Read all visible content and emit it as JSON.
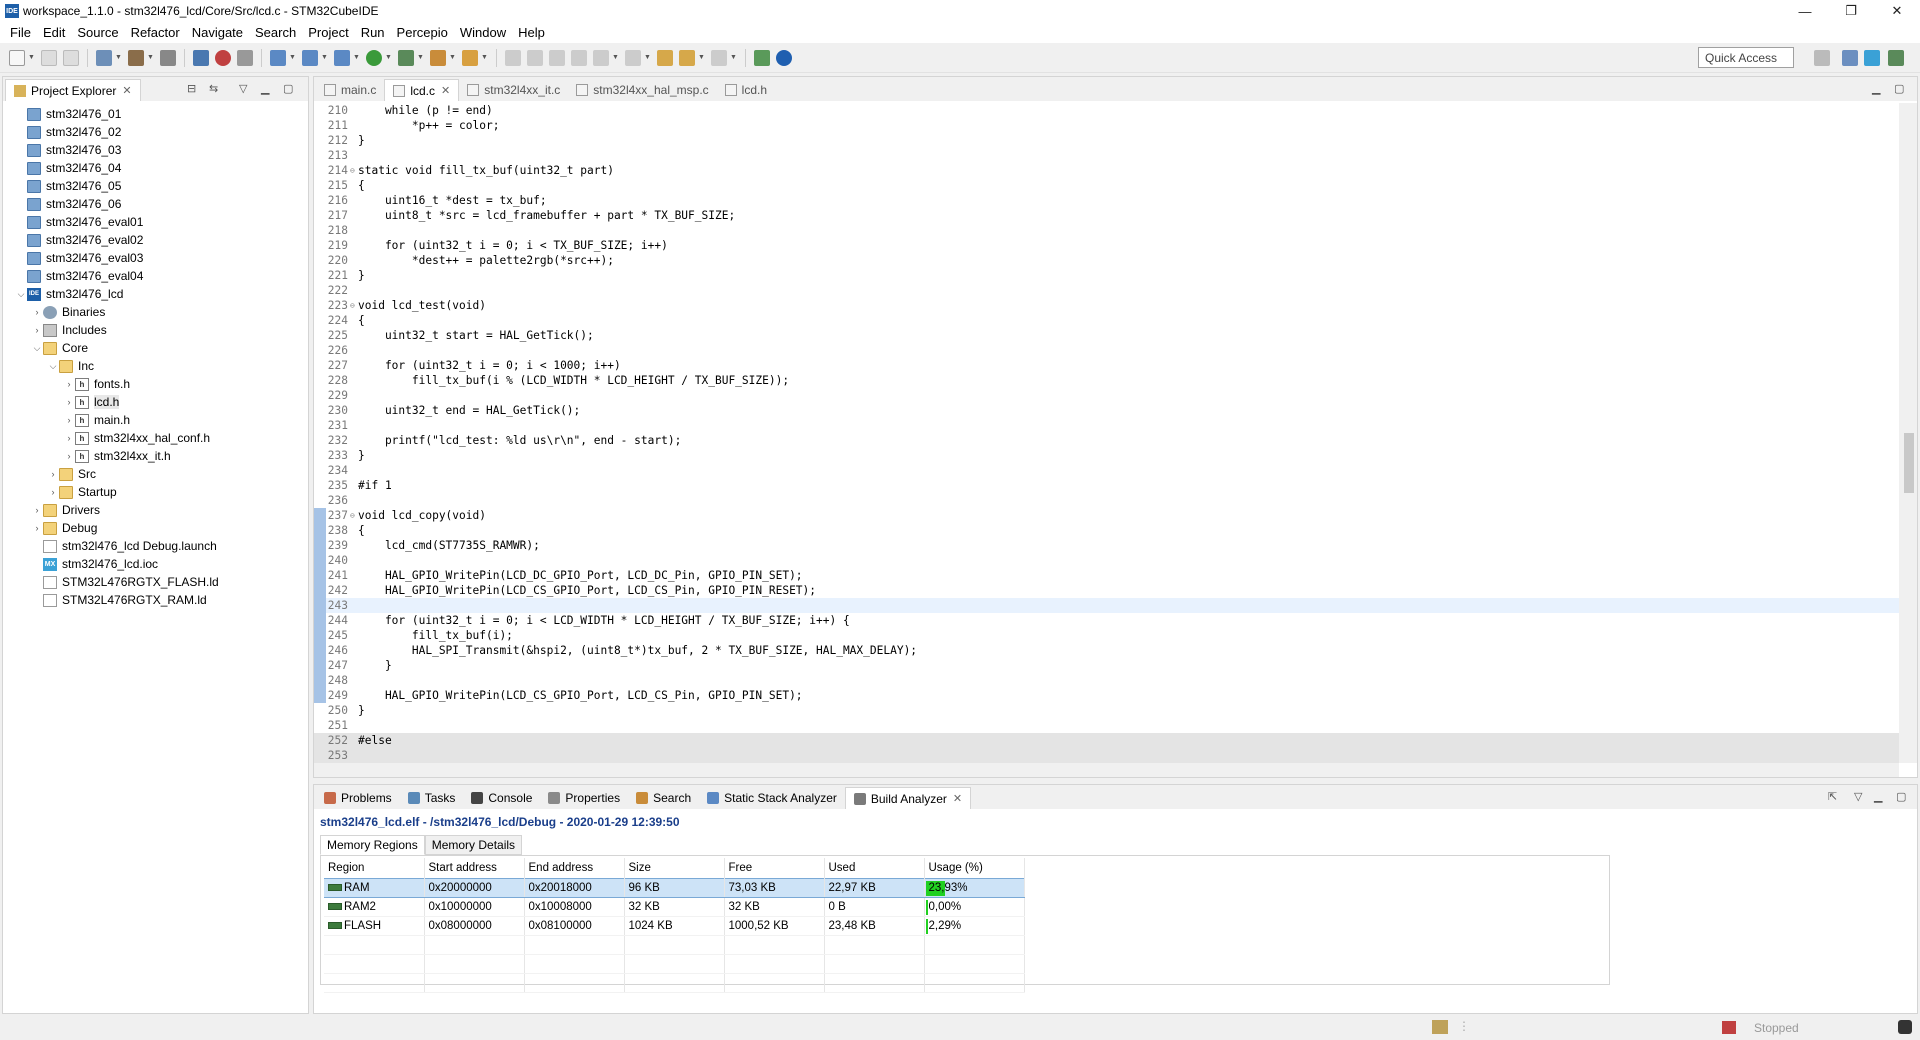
{
  "window": {
    "title": "workspace_1.1.0 - stm32l476_lcd/Core/Src/lcd.c - STM32CubeIDE",
    "app_icon_text": "IDE",
    "minimize": "—",
    "maximize": "❐",
    "close": "✕"
  },
  "menu": [
    "File",
    "Edit",
    "Source",
    "Refactor",
    "Navigate",
    "Search",
    "Project",
    "Run",
    "Percepio",
    "Window",
    "Help"
  ],
  "quick_access": "Quick Access",
  "explorer": {
    "title": "Project Explorer",
    "items": [
      {
        "label": "stm32l476_01",
        "icon": "project",
        "level": 0,
        "toggle": ""
      },
      {
        "label": "stm32l476_02",
        "icon": "project",
        "level": 0,
        "toggle": ""
      },
      {
        "label": "stm32l476_03",
        "icon": "project",
        "level": 0,
        "toggle": ""
      },
      {
        "label": "stm32l476_04",
        "icon": "project",
        "level": 0,
        "toggle": ""
      },
      {
        "label": "stm32l476_05",
        "icon": "project",
        "level": 0,
        "toggle": ""
      },
      {
        "label": "stm32l476_06",
        "icon": "project",
        "level": 0,
        "toggle": ""
      },
      {
        "label": "stm32l476_eval01",
        "icon": "project",
        "level": 0,
        "toggle": ""
      },
      {
        "label": "stm32l476_eval02",
        "icon": "project",
        "level": 0,
        "toggle": ""
      },
      {
        "label": "stm32l476_eval03",
        "icon": "project",
        "level": 0,
        "toggle": ""
      },
      {
        "label": "stm32l476_eval04",
        "icon": "project",
        "level": 0,
        "toggle": ""
      },
      {
        "label": "stm32l476_lcd",
        "icon": "ide",
        "level": 0,
        "toggle": "open"
      },
      {
        "label": "Binaries",
        "icon": "bin",
        "level": 1,
        "toggle": "closed"
      },
      {
        "label": "Includes",
        "icon": "inc",
        "level": 1,
        "toggle": "closed"
      },
      {
        "label": "Core",
        "icon": "folder",
        "level": 1,
        "toggle": "open"
      },
      {
        "label": "Inc",
        "icon": "folder",
        "level": 2,
        "toggle": "open"
      },
      {
        "label": "fonts.h",
        "icon": "h",
        "level": 3,
        "toggle": "closed"
      },
      {
        "label": "lcd.h",
        "icon": "h",
        "level": 3,
        "toggle": "closed",
        "selected": true
      },
      {
        "label": "main.h",
        "icon": "h",
        "level": 3,
        "toggle": "closed"
      },
      {
        "label": "stm32l4xx_hal_conf.h",
        "icon": "h",
        "level": 3,
        "toggle": "closed"
      },
      {
        "label": "stm32l4xx_it.h",
        "icon": "h",
        "level": 3,
        "toggle": "closed"
      },
      {
        "label": "Src",
        "icon": "folder",
        "level": 2,
        "toggle": "closed"
      },
      {
        "label": "Startup",
        "icon": "folder",
        "level": 2,
        "toggle": "closed"
      },
      {
        "label": "Drivers",
        "icon": "folder",
        "level": 1,
        "toggle": "closed"
      },
      {
        "label": "Debug",
        "icon": "folder",
        "level": 1,
        "toggle": "closed"
      },
      {
        "label": "stm32l476_lcd Debug.launch",
        "icon": "file",
        "level": 1,
        "toggle": ""
      },
      {
        "label": "stm32l476_lcd.ioc",
        "icon": "mx",
        "level": 1,
        "toggle": ""
      },
      {
        "label": "STM32L476RGTX_FLASH.ld",
        "icon": "file",
        "level": 1,
        "toggle": ""
      },
      {
        "label": "STM32L476RGTX_RAM.ld",
        "icon": "file",
        "level": 1,
        "toggle": ""
      }
    ]
  },
  "editor": {
    "tabs": [
      {
        "label": "main.c",
        "active": false
      },
      {
        "label": "lcd.c",
        "active": true
      },
      {
        "label": "stm32l4xx_it.c",
        "active": false
      },
      {
        "label": "stm32l4xx_hal_msp.c",
        "active": false
      },
      {
        "label": "lcd.h",
        "active": false
      }
    ],
    "lines": [
      {
        "n": "210",
        "t": "    while (p != end)"
      },
      {
        "n": "211",
        "t": "        *p++ = color;"
      },
      {
        "n": "212",
        "t": "}"
      },
      {
        "n": "213",
        "t": ""
      },
      {
        "n": "214",
        "t": "static void fill_tx_buf(uint32_t part)",
        "fold": true
      },
      {
        "n": "215",
        "t": "{"
      },
      {
        "n": "216",
        "t": "    uint16_t *dest = tx_buf;"
      },
      {
        "n": "217",
        "t": "    uint8_t *src = lcd_framebuffer + part * TX_BUF_SIZE;"
      },
      {
        "n": "218",
        "t": ""
      },
      {
        "n": "219",
        "t": "    for (uint32_t i = 0; i < TX_BUF_SIZE; i++)"
      },
      {
        "n": "220",
        "t": "        *dest++ = palette2rgb(*src++);"
      },
      {
        "n": "221",
        "t": "}"
      },
      {
        "n": "222",
        "t": ""
      },
      {
        "n": "223",
        "t": "void lcd_test(void)",
        "fold": true
      },
      {
        "n": "224",
        "t": "{"
      },
      {
        "n": "225",
        "t": "    uint32_t start = HAL_GetTick();"
      },
      {
        "n": "226",
        "t": ""
      },
      {
        "n": "227",
        "t": "    for (uint32_t i = 0; i < 1000; i++)"
      },
      {
        "n": "228",
        "t": "        fill_tx_buf(i % (LCD_WIDTH * LCD_HEIGHT / TX_BUF_SIZE));"
      },
      {
        "n": "229",
        "t": ""
      },
      {
        "n": "230",
        "t": "    uint32_t end = HAL_GetTick();"
      },
      {
        "n": "231",
        "t": ""
      },
      {
        "n": "232",
        "t": "    printf(\"lcd_test: %ld us\\r\\n\", end - start);"
      },
      {
        "n": "233",
        "t": "}"
      },
      {
        "n": "234",
        "t": ""
      },
      {
        "n": "235",
        "t": "#if 1"
      },
      {
        "n": "236",
        "t": ""
      },
      {
        "n": "237",
        "t": "void lcd_copy(void)",
        "fold": true,
        "mark": true
      },
      {
        "n": "238",
        "t": "{",
        "mark": true
      },
      {
        "n": "239",
        "t": "    lcd_cmd(ST7735S_RAMWR);",
        "mark": true
      },
      {
        "n": "240",
        "t": "",
        "mark": true
      },
      {
        "n": "241",
        "t": "    HAL_GPIO_WritePin(LCD_DC_GPIO_Port, LCD_DC_Pin, GPIO_PIN_SET);",
        "mark": true
      },
      {
        "n": "242",
        "t": "    HAL_GPIO_WritePin(LCD_CS_GPIO_Port, LCD_CS_Pin, GPIO_PIN_RESET);",
        "mark": true
      },
      {
        "n": "243",
        "t": "",
        "mark": true,
        "hl": true
      },
      {
        "n": "244",
        "t": "    for (uint32_t i = 0; i < LCD_WIDTH * LCD_HEIGHT / TX_BUF_SIZE; i++) {",
        "mark": true
      },
      {
        "n": "245",
        "t": "        fill_tx_buf(i);",
        "mark": true
      },
      {
        "n": "246",
        "t": "        HAL_SPI_Transmit(&hspi2, (uint8_t*)tx_buf, 2 * TX_BUF_SIZE, HAL_MAX_DELAY);",
        "mark": true
      },
      {
        "n": "247",
        "t": "    }",
        "mark": true
      },
      {
        "n": "248",
        "t": "",
        "mark": true
      },
      {
        "n": "249",
        "t": "    HAL_GPIO_WritePin(LCD_CS_GPIO_Port, LCD_CS_Pin, GPIO_PIN_SET);",
        "mark": true
      },
      {
        "n": "250",
        "t": "}"
      },
      {
        "n": "251",
        "t": ""
      },
      {
        "n": "252",
        "t": "#else",
        "grey": true
      },
      {
        "n": "253",
        "t": "",
        "grey": true
      }
    ]
  },
  "bottom": {
    "tabs": [
      {
        "label": "Problems",
        "active": false
      },
      {
        "label": "Tasks",
        "active": false
      },
      {
        "label": "Console",
        "active": false
      },
      {
        "label": "Properties",
        "active": false
      },
      {
        "label": "Search",
        "active": false
      },
      {
        "label": "Static Stack Analyzer",
        "active": false
      },
      {
        "label": "Build Analyzer",
        "active": true
      }
    ],
    "title": "stm32l476_lcd.elf - /stm32l476_lcd/Debug - 2020-01-29 12:39:50",
    "subtabs": [
      "Memory Regions",
      "Memory Details"
    ],
    "columns": [
      "Region",
      "Start address",
      "End address",
      "Size",
      "Free",
      "Used",
      "Usage (%)"
    ],
    "rows": [
      {
        "region": "RAM",
        "start": "0x20000000",
        "end": "0x20018000",
        "size": "96 KB",
        "free": "73,03 KB",
        "used": "22,97 KB",
        "usage": "23,93%",
        "usage_value": 0.2393
      },
      {
        "region": "RAM2",
        "start": "0x10000000",
        "end": "0x10008000",
        "size": "32 KB",
        "free": "32 KB",
        "used": "0 B",
        "usage": "0,00%",
        "usage_value": 0.0
      },
      {
        "region": "FLASH",
        "start": "0x08000000",
        "end": "0x08100000",
        "size": "1024 KB",
        "free": "1000,52 KB",
        "used": "23,48 KB",
        "usage": "2,29%",
        "usage_value": 0.0229
      }
    ]
  },
  "status": {
    "state": "Stopped"
  },
  "colors": {
    "usage_bar": "#21d021",
    "selected_row": "#cde3f7",
    "title_link": "#1a3e8a"
  }
}
